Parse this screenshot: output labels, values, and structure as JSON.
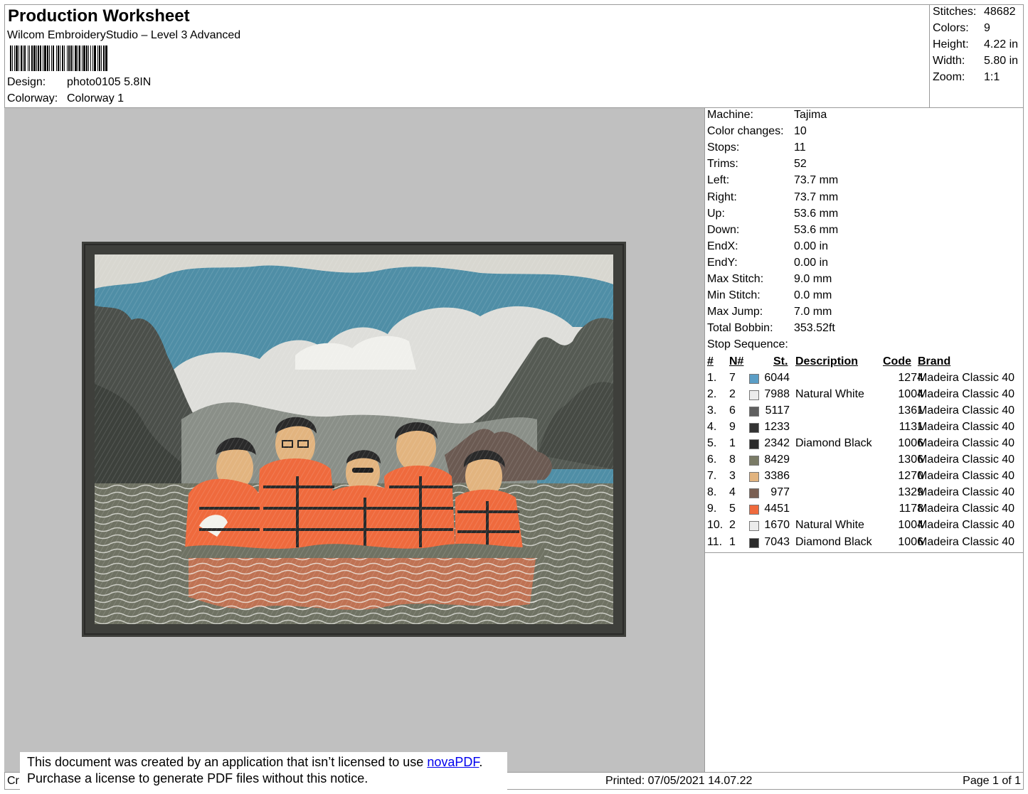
{
  "header": {
    "title": "Production Worksheet",
    "subtitle": "Wilcom EmbroideryStudio – Level 3 Advanced",
    "design_label": "Design:",
    "design_value": "photo0105 5.8IN",
    "colorway_label": "Colorway:",
    "colorway_value": "Colorway 1"
  },
  "stats": [
    {
      "label": "Stitches:",
      "value": "48682"
    },
    {
      "label": "Colors:",
      "value": "9"
    },
    {
      "label": "Height:",
      "value": "4.22 in"
    },
    {
      "label": "Width:",
      "value": "5.80 in"
    },
    {
      "label": "Zoom:",
      "value": "1:1"
    }
  ],
  "info": [
    {
      "label": "Machine:",
      "value": "Tajima"
    },
    {
      "label": "Color changes:",
      "value": "10"
    },
    {
      "label": "Stops:",
      "value": "11"
    },
    {
      "label": "Trims:",
      "value": "52"
    },
    {
      "label": "Left:",
      "value": "73.7 mm"
    },
    {
      "label": "Right:",
      "value": "73.7 mm"
    },
    {
      "label": "Up:",
      "value": "53.6 mm"
    },
    {
      "label": "Down:",
      "value": "53.6 mm"
    },
    {
      "label": "EndX:",
      "value": "0.00 in"
    },
    {
      "label": "EndY:",
      "value": "0.00 in"
    },
    {
      "label": "Max Stitch:",
      "value": "9.0 mm"
    },
    {
      "label": "Min Stitch:",
      "value": "0.0 mm"
    },
    {
      "label": "Max Jump:",
      "value": "7.0 mm"
    },
    {
      "label": "Total Bobbin:",
      "value": "353.52ft"
    }
  ],
  "stop_sequence": {
    "label": "Stop Sequence:",
    "headers": {
      "num": "#",
      "n": "N#",
      "st": "St.",
      "desc": "Description",
      "code": "Code",
      "brand": "Brand"
    },
    "rows": [
      {
        "num": "1.",
        "n": "7",
        "color": "#5b9ec6",
        "st": "6044",
        "desc": "",
        "code": "1274",
        "brand": "Madeira Classic 40"
      },
      {
        "num": "2.",
        "n": "2",
        "color": "#ececec",
        "st": "7988",
        "desc": "Natural White",
        "code": "1004",
        "brand": "Madeira Classic 40"
      },
      {
        "num": "3.",
        "n": "6",
        "color": "#5f5f5f",
        "st": "5117",
        "desc": "",
        "code": "1361",
        "brand": "Madeira Classic 40"
      },
      {
        "num": "4.",
        "n": "9",
        "color": "#333333",
        "st": "1233",
        "desc": "",
        "code": "1131",
        "brand": "Madeira Classic 40"
      },
      {
        "num": "5.",
        "n": "1",
        "color": "#2a2a2a",
        "st": "2342",
        "desc": "Diamond Black",
        "code": "1006",
        "brand": "Madeira Classic 40"
      },
      {
        "num": "6.",
        "n": "8",
        "color": "#7a7b66",
        "st": "8429",
        "desc": "",
        "code": "1306",
        "brand": "Madeira Classic 40"
      },
      {
        "num": "7.",
        "n": "3",
        "color": "#e2b47f",
        "st": "3386",
        "desc": "",
        "code": "1270",
        "brand": "Madeira Classic 40"
      },
      {
        "num": "8.",
        "n": "4",
        "color": "#7a5f52",
        "st": "977",
        "desc": "",
        "code": "1329",
        "brand": "Madeira Classic 40"
      },
      {
        "num": "9.",
        "n": "5",
        "color": "#ef6a3d",
        "st": "4451",
        "desc": "",
        "code": "1178",
        "brand": "Madeira Classic 40"
      },
      {
        "num": "10.",
        "n": "2",
        "color": "#ececec",
        "st": "1670",
        "desc": "Natural White",
        "code": "1004",
        "brand": "Madeira Classic 40"
      },
      {
        "num": "11.",
        "n": "1",
        "color": "#2a2a2a",
        "st": "7043",
        "desc": "Diamond Black",
        "code": "1006",
        "brand": "Madeira Classic 40"
      }
    ]
  },
  "footer": {
    "cr": "Cr",
    "printed": "Printed: 07/05/2021 14.07.22",
    "page": "Page 1 of 1"
  },
  "notice": {
    "line1_pre": "This document was created by an application that isn’t licensed to use ",
    "link": "novaPDF",
    "line1_post": ".",
    "line2": "Purchase a license to generate PDF files without this notice."
  }
}
